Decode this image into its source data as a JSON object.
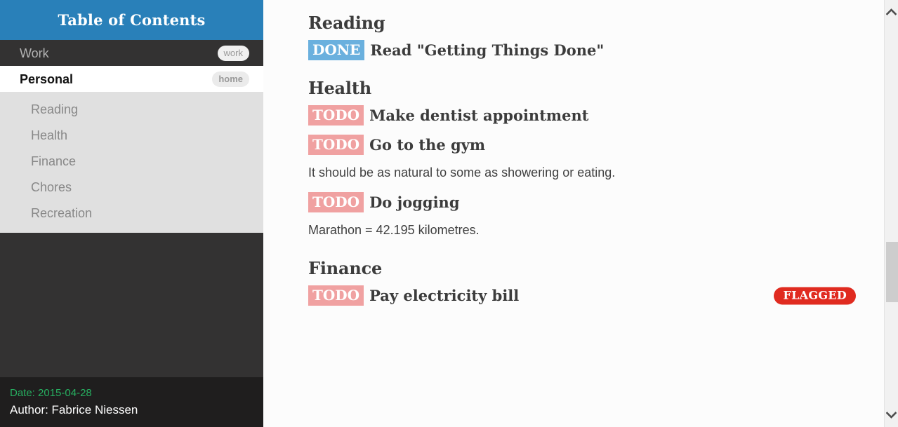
{
  "sidebar": {
    "header_title": "Table of Contents",
    "nav": [
      {
        "label": "Work",
        "tag": "work",
        "active": false
      },
      {
        "label": "Personal",
        "tag": "home",
        "active": true
      }
    ],
    "sub_items": [
      {
        "label": "Reading"
      },
      {
        "label": "Health"
      },
      {
        "label": "Finance"
      },
      {
        "label": "Chores"
      },
      {
        "label": "Recreation"
      }
    ],
    "footer": {
      "date": "Date: 2015-04-28",
      "author": "Author: Fabrice Niessen",
      "date_color": "#27ae60"
    }
  },
  "content": {
    "sections": [
      {
        "heading": "Reading",
        "blocks": [
          {
            "kind": "task",
            "keyword": "DONE",
            "keyword_type": "done",
            "title": "Read \"Getting Things Done\"",
            "flag": ""
          }
        ]
      },
      {
        "heading": "Health",
        "blocks": [
          {
            "kind": "task",
            "keyword": "TODO",
            "keyword_type": "todo",
            "title": "Make dentist appointment",
            "flag": ""
          },
          {
            "kind": "task",
            "keyword": "TODO",
            "keyword_type": "todo",
            "title": "Go to the gym",
            "flag": ""
          },
          {
            "kind": "text",
            "text": "It should be as natural to some as showering or eating."
          },
          {
            "kind": "task",
            "keyword": "TODO",
            "keyword_type": "todo",
            "title": "Do jogging",
            "flag": ""
          },
          {
            "kind": "text",
            "text": "Marathon = 42.195 kilometres."
          }
        ]
      },
      {
        "heading": "Finance",
        "blocks": [
          {
            "kind": "task",
            "keyword": "TODO",
            "keyword_type": "todo",
            "title": "Pay electricity bill",
            "flag": "FLAGGED"
          }
        ]
      }
    ]
  },
  "scrollbar": {
    "up_icon": "chevron-up-icon",
    "down_icon": "chevron-down-icon"
  },
  "colors": {
    "header_blue": "#2980b9",
    "sidebar_dark": "#333232",
    "done_badge": "#6ab0de",
    "todo_badge": "#f0a1a1",
    "flag_red": "#e02b20",
    "date_green": "#27ae60"
  }
}
